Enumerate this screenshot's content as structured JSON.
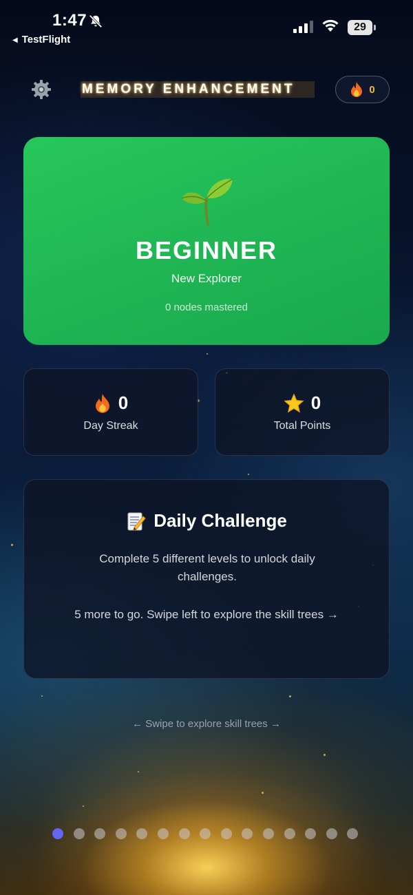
{
  "status_bar": {
    "time": "1:47",
    "back_app": "TestFlight",
    "battery": "29"
  },
  "header": {
    "title": "MEMORY ENHANCEMENT",
    "streak_count": "0"
  },
  "level_card": {
    "level": "BEGINNER",
    "subtitle": "New Explorer",
    "nodes": "0 nodes mastered",
    "color": "#22c55e"
  },
  "stats": [
    {
      "icon": "fire-icon",
      "value": "0",
      "label": "Day Streak"
    },
    {
      "icon": "star-icon",
      "value": "0",
      "label": "Total Points"
    }
  ],
  "daily_challenge": {
    "title": "Daily Challenge",
    "body": "Complete 5 different levels to unlock daily challenges.",
    "hint": "5 more to go. Swipe left to explore the skill trees →"
  },
  "swipe_hint": "← Swipe to explore skill trees →",
  "pagination": {
    "total": 15,
    "active": 1,
    "active_color": "#6366f1"
  }
}
